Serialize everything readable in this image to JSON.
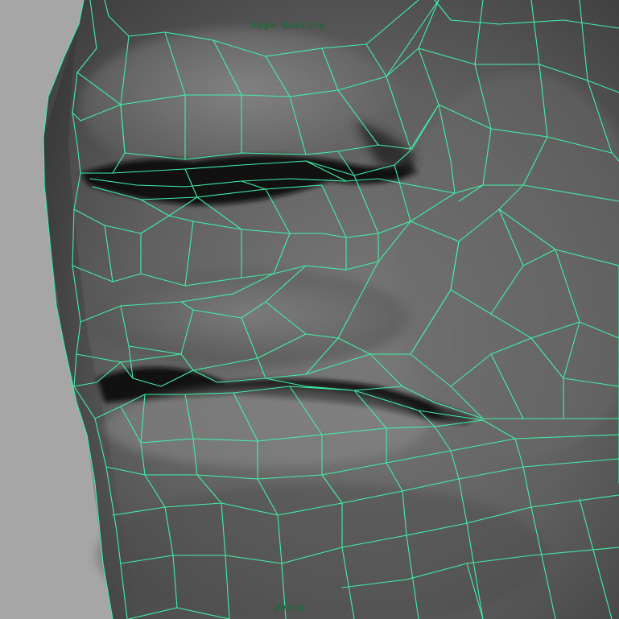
{
  "viewport": {
    "quality_label": "High Quality",
    "camera_label": "persp",
    "colors": {
      "background": "#a6a6a6",
      "wireframe": "#3ff0a8",
      "surface_light": "#8a8a8a",
      "surface_dark": "#2a2a2a",
      "hud_text": "#1f6f3a"
    }
  }
}
